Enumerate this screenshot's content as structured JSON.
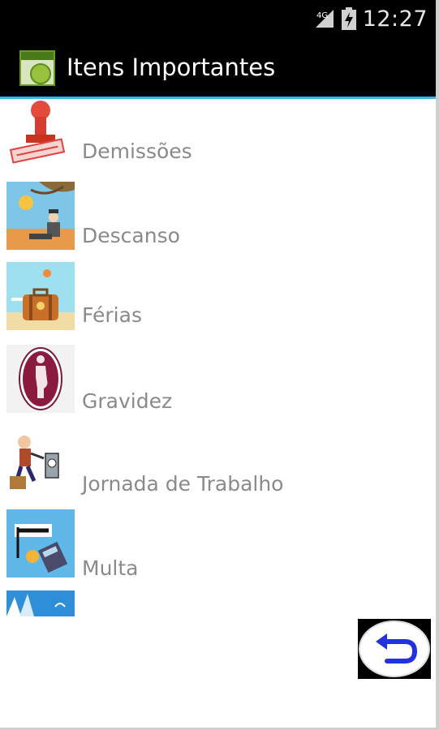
{
  "status_bar": {
    "network": "4G",
    "time": "12:27"
  },
  "action_bar": {
    "title": "Itens Importantes"
  },
  "items": [
    {
      "label": "Demissões",
      "icon": "rubber-stamp-icon"
    },
    {
      "label": "Descanso",
      "icon": "resting-man-icon"
    },
    {
      "label": "Férias",
      "icon": "suitcase-beach-icon"
    },
    {
      "label": "Gravidez",
      "icon": "pregnant-woman-icon"
    },
    {
      "label": "Jornada de Trabalho",
      "icon": "worker-clock-icon"
    },
    {
      "label": "Multa",
      "icon": "fine-calculator-icon"
    }
  ],
  "partial_item": {
    "icon": "partial-thumbnail-icon"
  },
  "back_button": {
    "icon": "back-arrow-icon"
  }
}
